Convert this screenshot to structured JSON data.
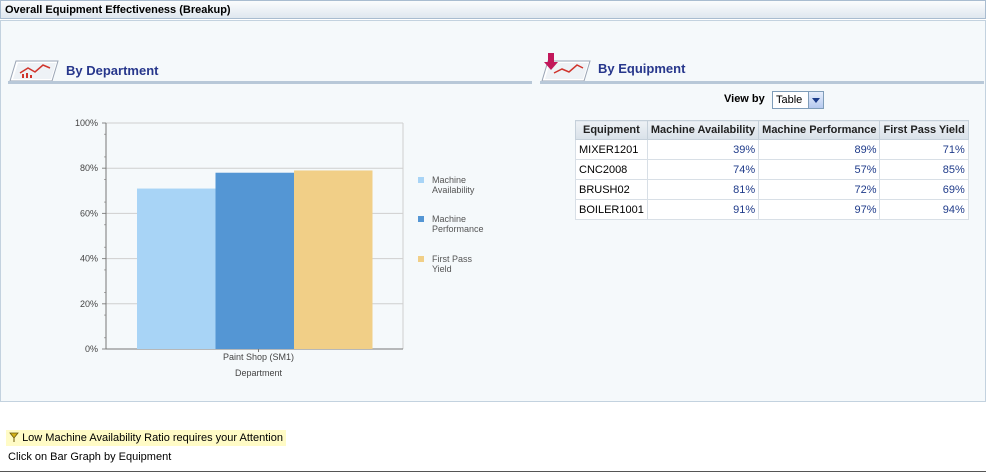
{
  "title": "Overall Equipment Effectiveness (Breakup)",
  "left_section": {
    "title": "By Department",
    "icon": "chart-icon"
  },
  "right_section": {
    "title": "By Equipment",
    "icon": "chart-download-icon"
  },
  "view_by": {
    "label": "View by",
    "value": "Table"
  },
  "table": {
    "headers": [
      "Equipment",
      "Machine Availability",
      "Machine Performance",
      "First Pass Yield"
    ],
    "rows": [
      [
        "MIXER1201",
        "39%",
        "89%",
        "71%"
      ],
      [
        "CNC2008",
        "74%",
        "57%",
        "85%"
      ],
      [
        "BRUSH02",
        "81%",
        "72%",
        "69%"
      ],
      [
        "BOILER1001",
        "91%",
        "97%",
        "94%"
      ]
    ]
  },
  "chart_data": {
    "type": "bar",
    "categories": [
      "Paint Shop (SM1)"
    ],
    "series": [
      {
        "name": "Machine Availability",
        "values": [
          71
        ],
        "color": "#a8d4f6"
      },
      {
        "name": "Machine Performance",
        "values": [
          78
        ],
        "color": "#5496d4"
      },
      {
        "name": "First Pass Yield",
        "values": [
          79
        ],
        "color": "#f1cf87"
      }
    ],
    "xlabel": "Department",
    "ylabel": "",
    "ylim": [
      0,
      100
    ],
    "yticks": [
      "0%",
      "20%",
      "40%",
      "60%",
      "80%",
      "100%"
    ],
    "legend": "right",
    "grid": true
  },
  "alert": {
    "text": "Low Machine Availability Ratio requires your Attention",
    "icon": "flag-icon"
  },
  "hint": "Click on Bar Graph by Equipment"
}
